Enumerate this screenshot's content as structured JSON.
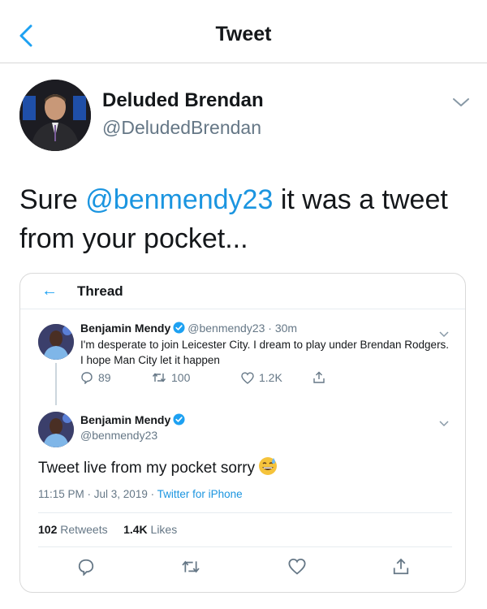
{
  "header": {
    "title": "Tweet"
  },
  "main_tweet": {
    "author_name": "Deluded Brendan",
    "author_handle": "@DeludedBrendan",
    "text_before": "Sure ",
    "mention": "@benmendy23",
    "text_after": " it was a tweet from your pocket..."
  },
  "embedded": {
    "header_title": "Thread",
    "tweet1": {
      "name": "Benjamin Mendy",
      "handle_time": "@benmendy23 · 30m",
      "text": "I'm desperate to join Leicester City. I dream to play under Brendan Rodgers. I hope Man City let it happen",
      "replies": "89",
      "retweets": "100",
      "likes": "1.2K"
    },
    "tweet2": {
      "name": "Benjamin Mendy",
      "handle": "@benmendy23",
      "text": "Tweet live from my pocket sorry",
      "timestamp": "11:15 PM · Jul 3, 2019 · ",
      "source": "Twitter for iPhone",
      "retweet_count": "102",
      "retweet_label": "Retweets",
      "like_count": "1.4K",
      "like_label": "Likes"
    }
  },
  "colors": {
    "accent": "#1da1f2",
    "link": "#1b95e0",
    "muted": "#657786",
    "text": "#14171a"
  }
}
